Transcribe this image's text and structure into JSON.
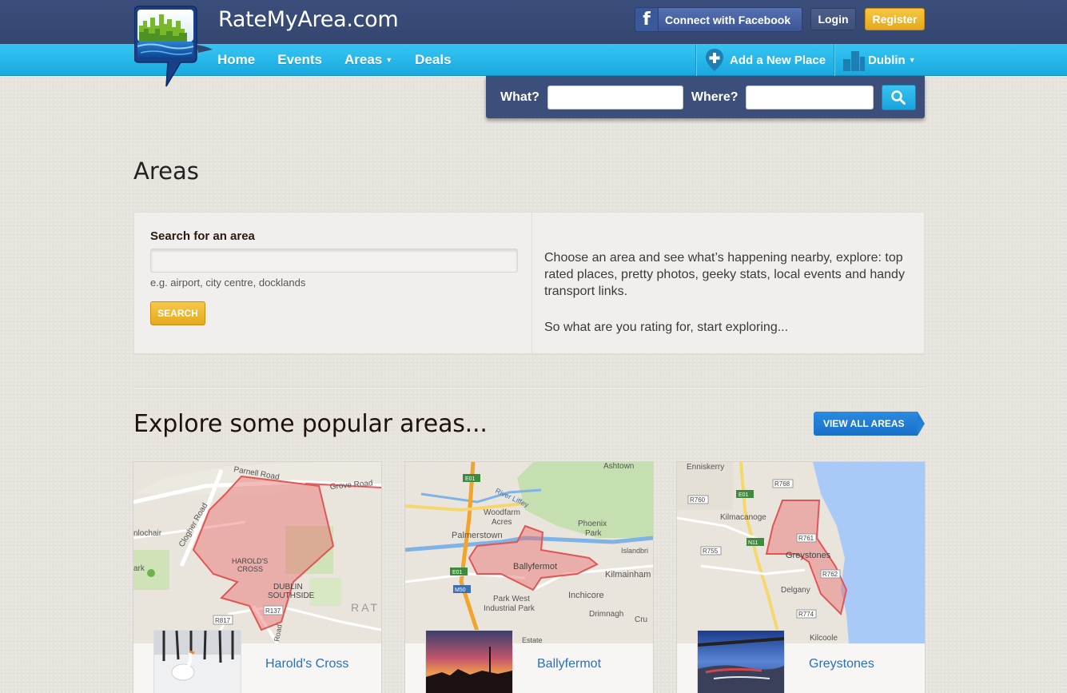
{
  "header": {
    "brand": "RateMyArea.com",
    "facebook_button": "Connect with Facebook",
    "login": "Login",
    "register": "Register"
  },
  "nav": {
    "items": [
      {
        "label": "Home",
        "dropdown": false
      },
      {
        "label": "Events",
        "dropdown": false
      },
      {
        "label": "Areas",
        "dropdown": true
      },
      {
        "label": "Deals",
        "dropdown": false
      }
    ],
    "add_place": "Add a New Place",
    "city": "Dublin"
  },
  "search_panel": {
    "what_label": "What?",
    "where_label": "Where?",
    "what_value": "",
    "where_value": ""
  },
  "page": {
    "title": "Areas",
    "search_label": "Search for an area",
    "search_value": "",
    "hint": "e.g. airport, city centre, docklands",
    "search_button": "SEARCH",
    "intro_1": "Choose an area and see what’s happening nearby, explore: top rated places, pretty photos, geeky stats, local events and handy transport links.",
    "intro_2": "So what are you rating for, start exploring..."
  },
  "popular": {
    "title": "Explore some popular areas...",
    "view_all": "VIEW ALL AREAS",
    "areas": [
      {
        "name": "Harold's Cross",
        "map_labels": [
          "Parnell Road",
          "Grove Road",
          "Clogher Road",
          "nlochair",
          "ark",
          "HAROLD'S",
          "CROSS",
          "DUBLIN",
          "SOUTHSIDE",
          "R137",
          "R817",
          "RAT",
          "Road"
        ]
      },
      {
        "name": "Ballyfermot",
        "map_labels": [
          "Ashtown",
          "E01",
          "River Liffey",
          "Woodfarm",
          "Acres",
          "Palmerstown",
          "Phoenix",
          "Park",
          "Islandbri",
          "Ballyfermot",
          "E01",
          "M50",
          "Kilmainham",
          "Inchicore",
          "Park West",
          "Industrial Park",
          "Drimnagh",
          "Cru",
          "Estate"
        ]
      },
      {
        "name": "Greystones",
        "map_labels": [
          "Enniskerry",
          "R768",
          "R760",
          "E01",
          "Kilmacanoge",
          "R755",
          "N11",
          "R761",
          "Greystones",
          "R762",
          "Delgany",
          "R774",
          "Kilcoole"
        ]
      }
    ]
  },
  "colors": {
    "header_bg": "#3b4e7b",
    "nav_bg": "#1aa9e0",
    "accent_yellow": "#e6a81b",
    "link_blue": "#2a6fc0",
    "area_polygon": "#e86b6b"
  }
}
